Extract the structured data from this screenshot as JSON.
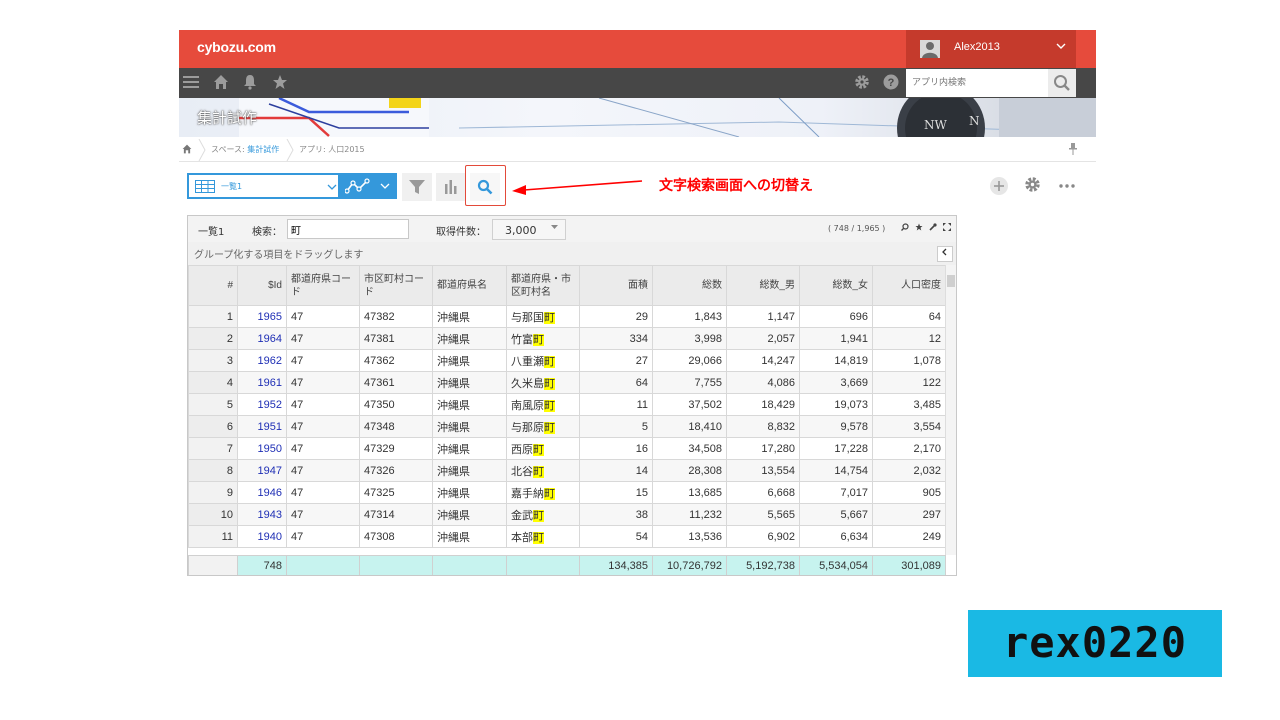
{
  "header": {
    "logo": "cybozu.com",
    "user_name": "Alex2013",
    "app_search_placeholder": "アプリ内検索",
    "banner_title": "集計試作"
  },
  "breadcrumb": {
    "space_prefix": "スペース: ",
    "space_name": "集計試作",
    "app_prefix": "アプリ: ",
    "app_name": "人口2015"
  },
  "toolbar": {
    "view_name": "一覧1",
    "callout_text": "文字検索画面への切替え"
  },
  "grid": {
    "list_name": "一覧1",
    "search_label": "検索：",
    "search_value": "町",
    "fetch_label": "取得件数：",
    "fetch_value": "3,000",
    "record_count": "( 748 / 1,965 )",
    "group_hint": "グループ化する項目をドラッグします",
    "columns": [
      "#",
      "$Id",
      "都道府県コード",
      "市区町村コード",
      "都道府県名",
      "都道府県・市区町村名",
      "面積",
      "総数",
      "総数_男",
      "総数_女",
      "人口密度"
    ],
    "rows": [
      {
        "n": "1",
        "id": "1965",
        "pref": "47",
        "city": "47382",
        "pname": "沖縄県",
        "cname": "与那国",
        "suffix": "町",
        "area": "29",
        "total": "1,843",
        "male": "1,147",
        "female": "696",
        "density": "64"
      },
      {
        "n": "2",
        "id": "1964",
        "pref": "47",
        "city": "47381",
        "pname": "沖縄県",
        "cname": "竹富",
        "suffix": "町",
        "area": "334",
        "total": "3,998",
        "male": "2,057",
        "female": "1,941",
        "density": "12"
      },
      {
        "n": "3",
        "id": "1962",
        "pref": "47",
        "city": "47362",
        "pname": "沖縄県",
        "cname": "八重瀬",
        "suffix": "町",
        "area": "27",
        "total": "29,066",
        "male": "14,247",
        "female": "14,819",
        "density": "1,078"
      },
      {
        "n": "4",
        "id": "1961",
        "pref": "47",
        "city": "47361",
        "pname": "沖縄県",
        "cname": "久米島",
        "suffix": "町",
        "area": "64",
        "total": "7,755",
        "male": "4,086",
        "female": "3,669",
        "density": "122"
      },
      {
        "n": "5",
        "id": "1952",
        "pref": "47",
        "city": "47350",
        "pname": "沖縄県",
        "cname": "南風原",
        "suffix": "町",
        "area": "11",
        "total": "37,502",
        "male": "18,429",
        "female": "19,073",
        "density": "3,485"
      },
      {
        "n": "6",
        "id": "1951",
        "pref": "47",
        "city": "47348",
        "pname": "沖縄県",
        "cname": "与那原",
        "suffix": "町",
        "area": "5",
        "total": "18,410",
        "male": "8,832",
        "female": "9,578",
        "density": "3,554"
      },
      {
        "n": "7",
        "id": "1950",
        "pref": "47",
        "city": "47329",
        "pname": "沖縄県",
        "cname": "西原",
        "suffix": "町",
        "area": "16",
        "total": "34,508",
        "male": "17,280",
        "female": "17,228",
        "density": "2,170"
      },
      {
        "n": "8",
        "id": "1947",
        "pref": "47",
        "city": "47326",
        "pname": "沖縄県",
        "cname": "北谷",
        "suffix": "町",
        "area": "14",
        "total": "28,308",
        "male": "13,554",
        "female": "14,754",
        "density": "2,032"
      },
      {
        "n": "9",
        "id": "1946",
        "pref": "47",
        "city": "47325",
        "pname": "沖縄県",
        "cname": "嘉手納",
        "suffix": "町",
        "area": "15",
        "total": "13,685",
        "male": "6,668",
        "female": "7,017",
        "density": "905"
      },
      {
        "n": "10",
        "id": "1943",
        "pref": "47",
        "city": "47314",
        "pname": "沖縄県",
        "cname": "金武",
        "suffix": "町",
        "area": "38",
        "total": "11,232",
        "male": "5,565",
        "female": "5,667",
        "density": "297"
      },
      {
        "n": "11",
        "id": "1940",
        "pref": "47",
        "city": "47308",
        "pname": "沖縄県",
        "cname": "本部",
        "suffix": "町",
        "area": "54",
        "total": "13,536",
        "male": "6,902",
        "female": "6,634",
        "density": "249"
      }
    ],
    "summary": {
      "id": "748",
      "area": "134,385",
      "total": "10,726,792",
      "male": "5,192,738",
      "female": "5,534,054",
      "density": "301,089"
    }
  },
  "watermark": "rex0220",
  "colors": {
    "header_red": "#e64b3c",
    "nav_dark": "#474747",
    "accent_blue": "#3498db",
    "highlight_yellow": "#ffff00",
    "summary_cyan": "#c7f3ef",
    "callout_red": "#ff0000"
  }
}
